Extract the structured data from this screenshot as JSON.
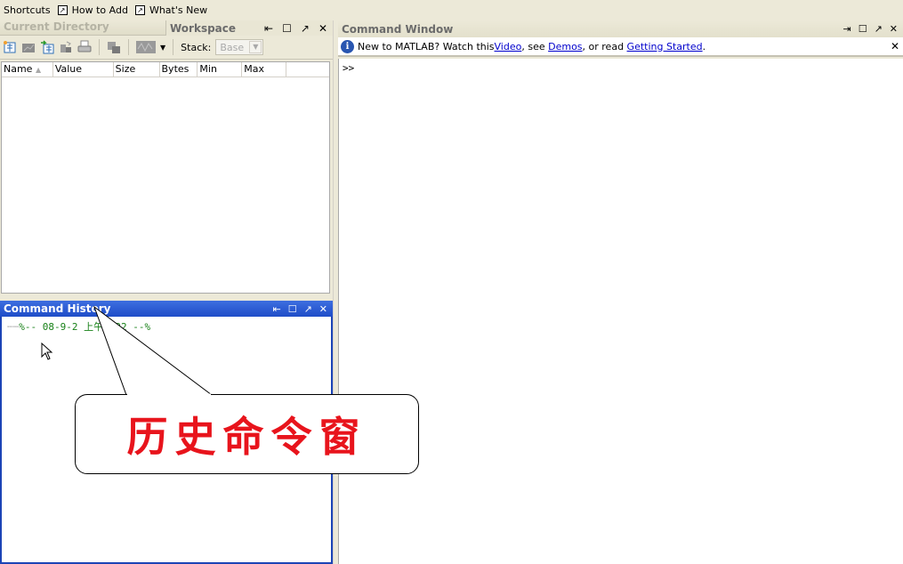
{
  "shortcuts_bar": {
    "items": [
      {
        "label": "Shortcuts",
        "icon": null
      },
      {
        "label": "How to Add",
        "icon": "shortcut-arrow-icon"
      },
      {
        "label": "What's New",
        "icon": "shortcut-arrow-icon"
      }
    ]
  },
  "workspace_pane": {
    "tabs": [
      {
        "label": "Current Directory",
        "active": false
      },
      {
        "label": "Workspace",
        "active": true
      }
    ],
    "window_controls": [
      "undock-icon",
      "maximize-icon",
      "popout-icon",
      "close-icon"
    ],
    "toolbar": {
      "icons": [
        "new-variable-icon",
        "open-selection-icon",
        "import-data-icon",
        "save-icon",
        "print-icon",
        "delete-icon",
        "plot-icon",
        "plot-dropdown-icon"
      ],
      "stack_label": "Stack:",
      "stack_value": "Base"
    },
    "columns": [
      "Name",
      "Value",
      "Size",
      "Bytes",
      "Min",
      "Max"
    ],
    "sort_indicator": "ascending",
    "rows": []
  },
  "command_history": {
    "title": "Command History",
    "lines": [
      {
        "text": "%-- 08-9-2 上午 :22 --%"
      }
    ]
  },
  "command_window": {
    "title": "Command Window",
    "info": {
      "prefix": "New to MATLAB? Watch this ",
      "link_video": "Video",
      "mid1": ", see ",
      "link_demos": "Demos",
      "mid2": ", or read ",
      "link_getting_started": "Getting Started",
      "suffix": "."
    },
    "prompt": ">>"
  },
  "callout": {
    "text": "历史命令窗"
  },
  "colors": {
    "callout_text": "#e8141c",
    "active_title": "#1f4dc8",
    "history_text": "#188118",
    "link": "#0000cc"
  }
}
